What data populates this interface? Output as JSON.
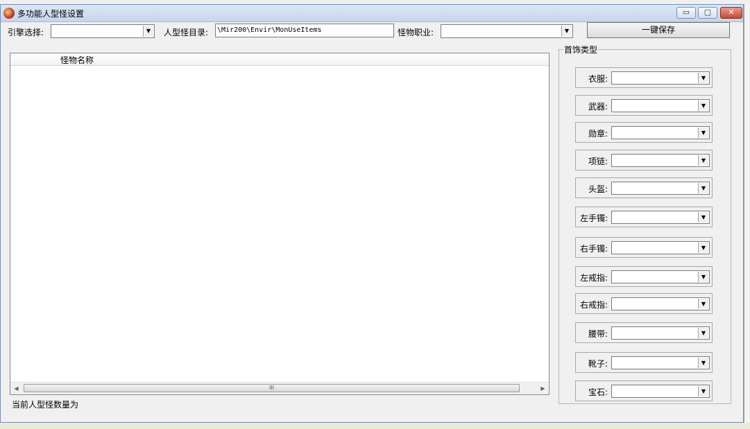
{
  "window": {
    "title": "多功能人型怪设置",
    "controls": {
      "minimize": "▭",
      "maximize": "▢",
      "close": "✕"
    }
  },
  "toolbar": {
    "engine_label": "引擎选择:",
    "engine_value": "",
    "dir_label": "人型怪目录:",
    "dir_value": "\\Mir200\\Envir\\MonUseItems",
    "job_label": "怪物职业:",
    "job_value": "",
    "save_label": "一键保存"
  },
  "list": {
    "column_header": "怪物名称",
    "rows": [],
    "scroll_grip": "III"
  },
  "status_text": "当前人型怪数量为",
  "jewelry": {
    "group_title": "首饰类型",
    "slots": [
      {
        "label": "衣服:",
        "value": ""
      },
      {
        "label": "武器:",
        "value": ""
      },
      {
        "label": "勋章:",
        "value": ""
      },
      {
        "label": "项链:",
        "value": ""
      },
      {
        "label": "头盔:",
        "value": ""
      },
      {
        "label": "左手镯:",
        "value": ""
      },
      {
        "label": "右手镯:",
        "value": ""
      },
      {
        "label": "左戒指:",
        "value": ""
      },
      {
        "label": "右戒指:",
        "value": ""
      },
      {
        "label": "腰带:",
        "value": ""
      },
      {
        "label": "靴子:",
        "value": ""
      },
      {
        "label": "宝石:",
        "value": ""
      }
    ]
  },
  "icons": {
    "dropdown": "chevron-down-icon",
    "scroll_left": "arrow-left-icon",
    "scroll_right": "arrow-right-icon",
    "app": "app-icon"
  }
}
